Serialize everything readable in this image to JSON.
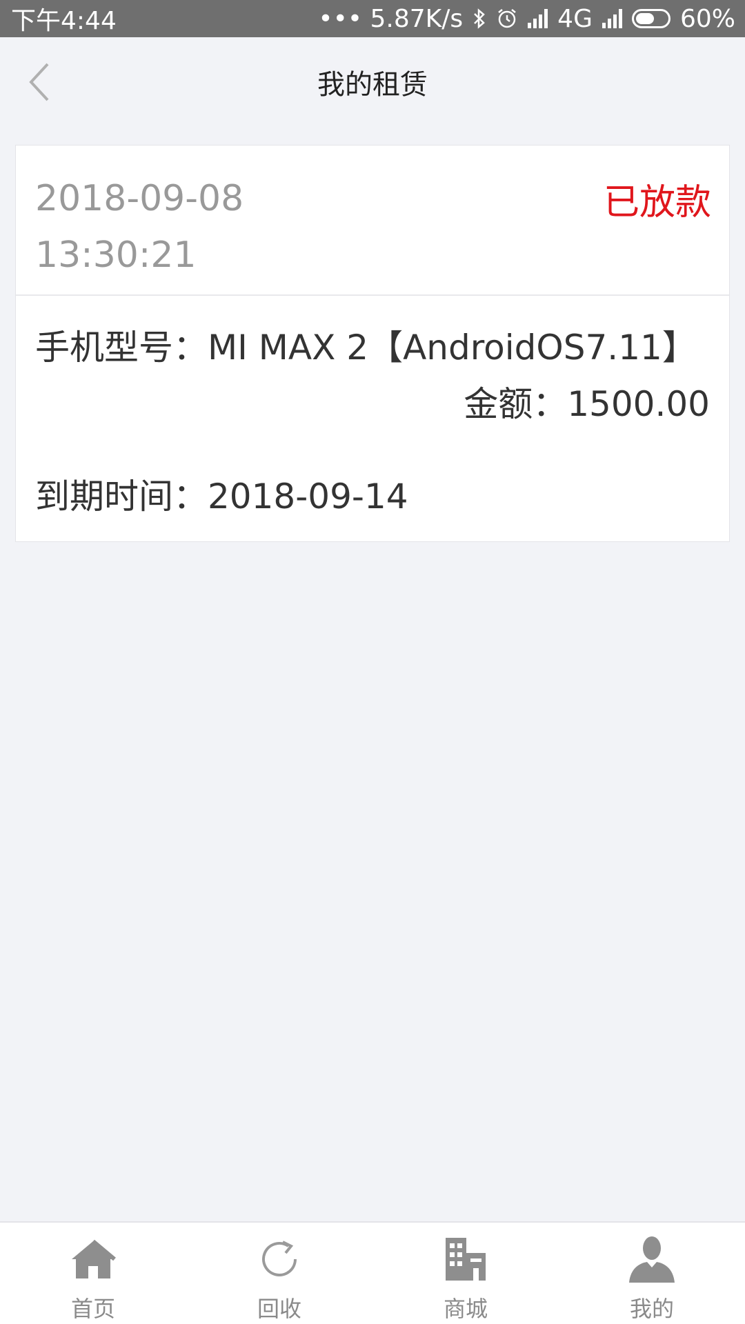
{
  "status_bar": {
    "time": "下午4:44",
    "network_speed": "••• 5.87K/s",
    "network_type": "4G",
    "battery_percent": "60%",
    "battery_level": 0.6
  },
  "header": {
    "title": "我的租赁",
    "back_icon": "chevron-left-icon"
  },
  "order": {
    "date": "2018-09-08",
    "time": "13:30:21",
    "status": "已放款",
    "status_color": "#e0161c",
    "model": "手机型号：MI MAX 2【AndroidOS7.11】",
    "amount": "金额：1500.00",
    "expire": "到期时间：2018-09-14"
  },
  "tabs": [
    {
      "label": "首页",
      "icon": "home-icon"
    },
    {
      "label": "回收",
      "icon": "recycle-icon"
    },
    {
      "label": "商城",
      "icon": "mall-icon"
    },
    {
      "label": "我的",
      "icon": "user-icon"
    }
  ]
}
